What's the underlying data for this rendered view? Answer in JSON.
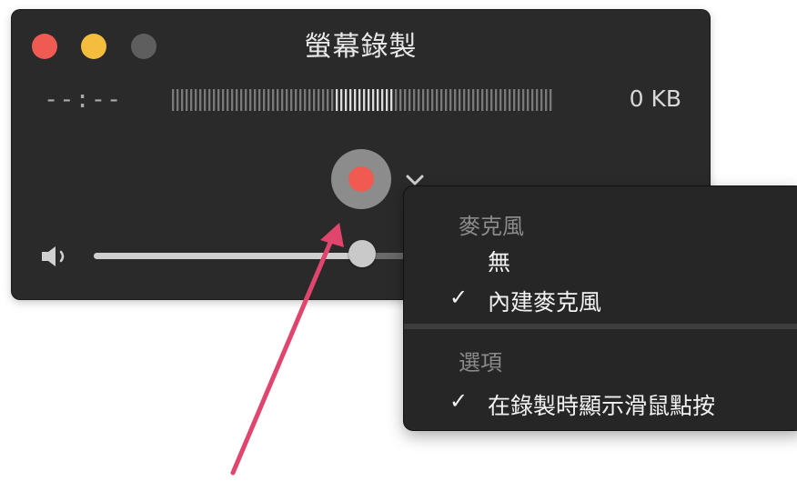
{
  "window": {
    "title": "螢幕錄製",
    "timer": "--:--",
    "file_size": "0 KB",
    "volume_level": 0.72
  },
  "traffic_lights": {
    "close_color": "#ef5a53",
    "minimize_color": "#f4bd3e",
    "zoom_color": "#5e5e5e"
  },
  "record_button": {
    "icon": "record-icon",
    "color": "#f05a50"
  },
  "menu": {
    "microphone_section": "麥克風",
    "microphone_items": [
      {
        "label": "無",
        "checked": false
      },
      {
        "label": "內建麥克風",
        "checked": true
      }
    ],
    "options_section": "選項",
    "options_items": [
      {
        "label": "在錄製時顯示滑鼠點按",
        "checked": true
      }
    ]
  },
  "annotation": {
    "arrow_color": "#e0456e"
  },
  "check_mark": "✓"
}
